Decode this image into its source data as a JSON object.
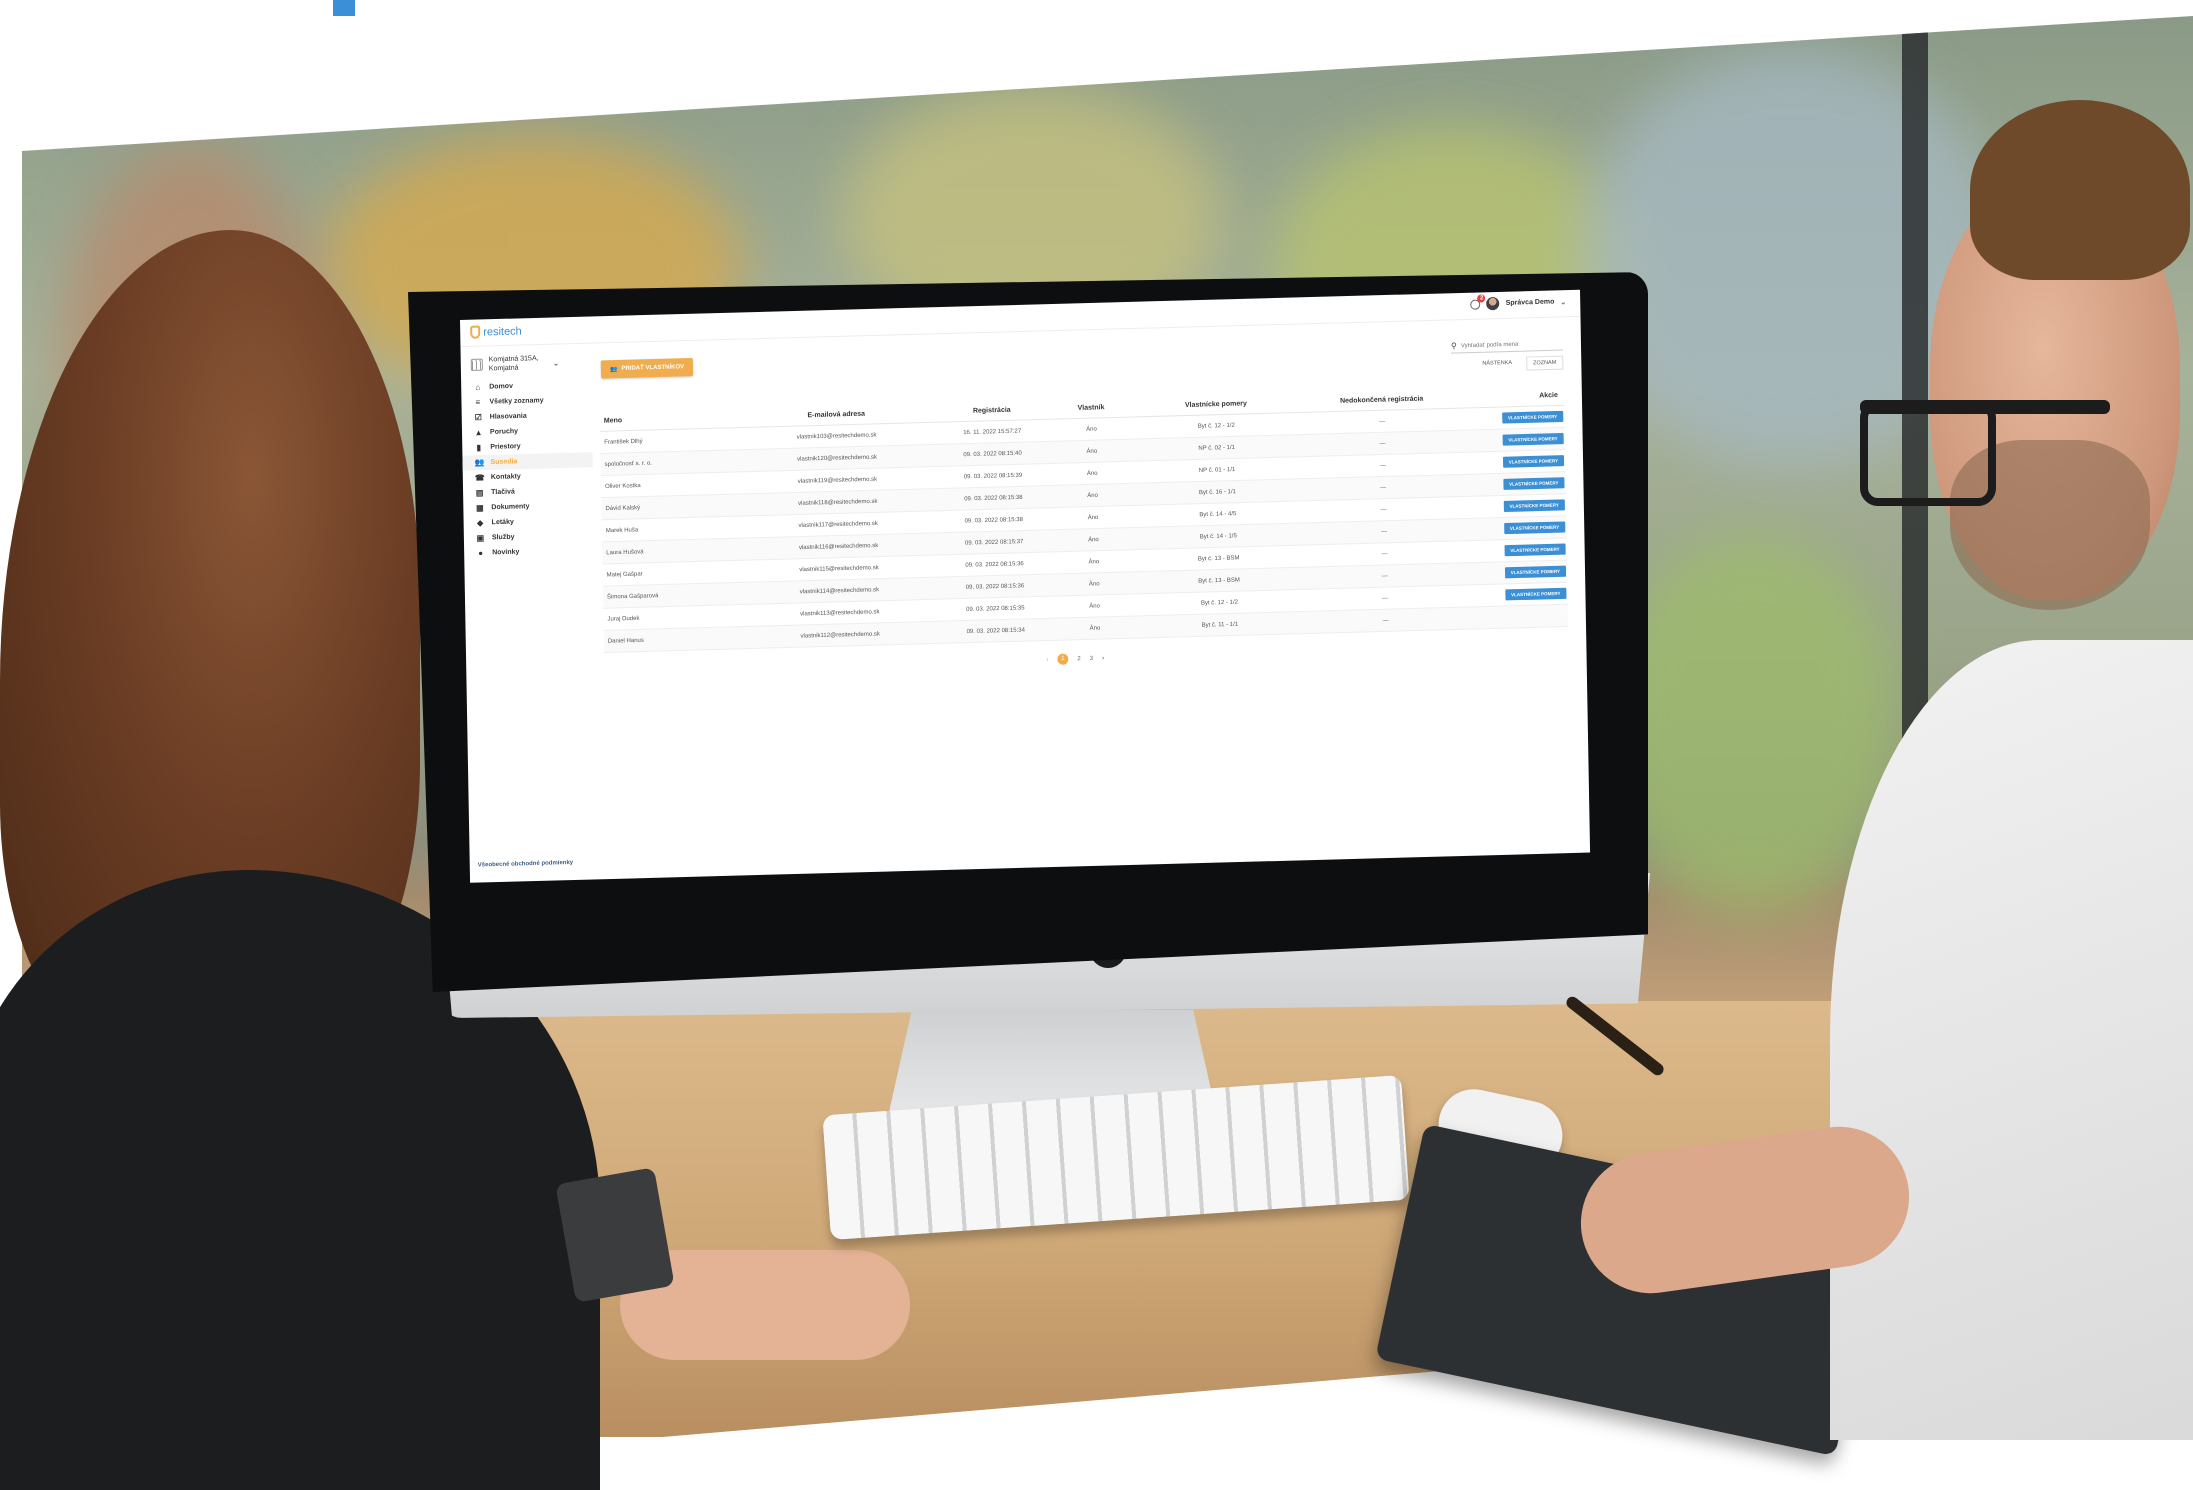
{
  "app": {
    "logo_text": "resitech",
    "brand_color": "#3b8fd5",
    "accent_color": "#f0ad4e"
  },
  "header": {
    "notifications_count": "2",
    "user_name": "Správca Demo"
  },
  "sidebar": {
    "building_line1": "Komjatná 315A,",
    "building_line2": "Komjatná",
    "items": [
      {
        "label": "Domov",
        "icon": "home-icon"
      },
      {
        "label": "Všetky zoznamy",
        "icon": "list-icon"
      },
      {
        "label": "Hlasovania",
        "icon": "ballot-icon"
      },
      {
        "label": "Poruchy",
        "icon": "warning-icon"
      },
      {
        "label": "Priestory",
        "icon": "door-icon"
      },
      {
        "label": "Susedia",
        "icon": "people-icon",
        "active": true
      },
      {
        "label": "Kontakty",
        "icon": "contacts-icon"
      },
      {
        "label": "Tlačivá",
        "icon": "forms-icon"
      },
      {
        "label": "Dokumenty",
        "icon": "document-icon"
      },
      {
        "label": "Letáky",
        "icon": "tag-icon"
      },
      {
        "label": "Služby",
        "icon": "services-icon"
      },
      {
        "label": "Novinky",
        "icon": "news-icon"
      }
    ],
    "terms": "Všeobecné obchodné podmienky"
  },
  "toolbar": {
    "add_label": "PRIDAŤ VLASTNÍKOV",
    "search_placeholder": "Vyhľadať podľa mena",
    "view_board": "NÁSTENKA",
    "view_list": "ZOZNAM"
  },
  "table": {
    "headers": [
      "Meno",
      "E-mailová adresa",
      "Registrácia",
      "Vlastník",
      "Vlastnícke pomery",
      "Nedokončená registrácia",
      "Akcie"
    ],
    "action_label": "VLASTNÍCKE POMERY",
    "rows": [
      {
        "name": "František Dlhý",
        "email": "vlastnik103@resitechdemo.sk",
        "reg": "16. 11. 2022 15:57:27",
        "owner": "Áno",
        "ratio": "Byt č. 12 - 1/2",
        "pending": "—"
      },
      {
        "name": "spoločnosť s. r. o.",
        "email": "vlastnik120@resitechdemo.sk",
        "reg": "09. 03. 2022 08:15:40",
        "owner": "Áno",
        "ratio": "NP č. 02 - 1/1",
        "pending": "—"
      },
      {
        "name": "Oliver Kostka",
        "email": "vlastnik119@resitechdemo.sk",
        "reg": "09. 03. 2022 08:15:39",
        "owner": "Áno",
        "ratio": "NP č. 01 - 1/1",
        "pending": "—"
      },
      {
        "name": "Dávid Kalský",
        "email": "vlastnik118@resitechdemo.sk",
        "reg": "09. 03. 2022 08:15:38",
        "owner": "Áno",
        "ratio": "Byt č. 16 - 1/1",
        "pending": "—"
      },
      {
        "name": "Marek Huša",
        "email": "vlastnik117@resitechdemo.sk",
        "reg": "09. 03. 2022 08:15:38",
        "owner": "Áno",
        "ratio": "Byt č. 14 - 4/5",
        "pending": "—"
      },
      {
        "name": "Laura Hušová",
        "email": "vlastnik116@resitechdemo.sk",
        "reg": "09. 03. 2022 08:15:37",
        "owner": "Áno",
        "ratio": "Byt č. 14 - 1/5",
        "pending": "—"
      },
      {
        "name": "Matej Gašpar",
        "email": "vlastnik115@resitechdemo.sk",
        "reg": "09. 03. 2022 08:15:36",
        "owner": "Áno",
        "ratio": "Byt č. 13 - BSM",
        "pending": "—"
      },
      {
        "name": "Šimona Gašparová",
        "email": "vlastnik114@resitechdemo.sk",
        "reg": "09. 03. 2022 08:15:36",
        "owner": "Áno",
        "ratio": "Byt č. 13 - BSM",
        "pending": "—"
      },
      {
        "name": "Juraj Dudek",
        "email": "vlastnik113@resitechdemo.sk",
        "reg": "09. 03. 2022 08:15:35",
        "owner": "Áno",
        "ratio": "Byt č. 12 - 1/2",
        "pending": "—"
      },
      {
        "name": "Daniel Hanus",
        "email": "vlastnik112@resitechdemo.sk",
        "reg": "09. 03. 2022 08:15:34",
        "owner": "Áno",
        "ratio": "Byt č. 11 - 1/1",
        "pending": "—"
      }
    ]
  },
  "pagination": {
    "pages": [
      "1",
      "2",
      "3"
    ],
    "current": "1"
  }
}
